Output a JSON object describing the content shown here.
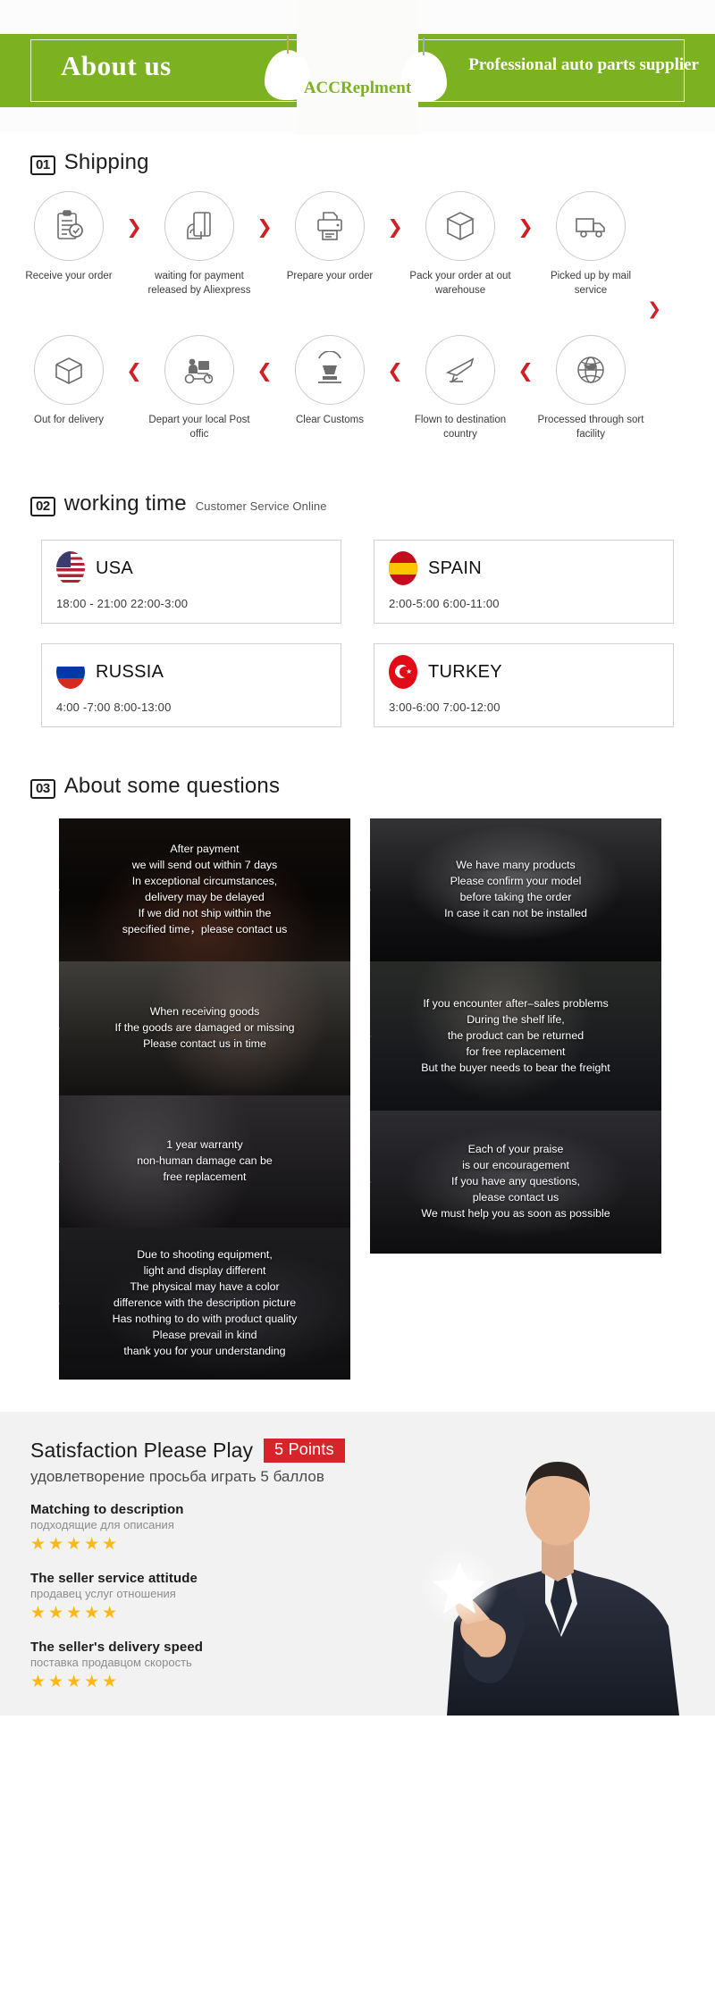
{
  "header": {
    "title": "About us",
    "slogan": "Professional auto parts supplier",
    "logo_text": "ACCReplment",
    "band_color": "#7cb122"
  },
  "shipping": {
    "number": "01",
    "title": "Shipping",
    "arrow_right": "❯",
    "arrow_down": "❯",
    "row1": [
      {
        "icon": "clipboard-check-icon",
        "label": "Receive your order"
      },
      {
        "icon": "hand-card-icon",
        "label": "waiting for payment\nreleased by Aliexpress"
      },
      {
        "icon": "printer-icon",
        "label": "Prepare your order"
      },
      {
        "icon": "box-icon",
        "label": "Pack your order at\nout warehouse"
      },
      {
        "icon": "truck-icon",
        "label": "Picked up by\nmail service"
      }
    ],
    "row2": [
      {
        "icon": "open-box-icon",
        "label": "Out  for delivery"
      },
      {
        "icon": "scooter-courier-icon",
        "label": "Depart your local\nPost offic"
      },
      {
        "icon": "customs-stamp-icon",
        "label": "Clear Customs"
      },
      {
        "icon": "airplane-icon",
        "label": "Flown to\ndestination country"
      },
      {
        "icon": "globe-icon",
        "label": "Processed through\nsort facility"
      }
    ]
  },
  "working_time": {
    "number": "02",
    "title": "working time",
    "subtitle": "Customer Service Online",
    "cards": [
      {
        "flag": "flag-usa-icon",
        "country": "USA",
        "hours": "18:00 - 21:00   22:00-3:00"
      },
      {
        "flag": "flag-spain-icon",
        "country": "SPAIN",
        "hours": "2:00-5:00    6:00-11:00"
      },
      {
        "flag": "flag-russia-icon",
        "country": "RUSSIA",
        "hours": "4:00 -7:00   8:00-13:00"
      },
      {
        "flag": "flag-turkey-icon",
        "country": "TURKEY",
        "hours": "3:00-6:00    7:00-12:00"
      }
    ]
  },
  "questions": {
    "number": "03",
    "title": "About some questions",
    "left_column": [
      {
        "marker_color": "#f07a7a",
        "text": "After payment\nwe will send out within 7 days\nIn exceptional circumstances,\ndelivery may be delayed\nIf we did not ship within the\nspecified time，please contact us"
      },
      {
        "marker_color": "#3ddcc0",
        "text": "When receiving goods\nIf the goods are damaged or missing\nPlease contact us in time"
      },
      {
        "marker_color": "#3ddcc0",
        "text": "1 year warranty\nnon-human damage can be\nfree replacement"
      },
      {
        "marker_color": "#e14ec0",
        "text": "Due to shooting equipment,\nlight and display different\nThe physical may have a color\ndifference with the description picture\nHas nothing to do with product quality\nPlease prevail in kind\nthank you for your understanding"
      }
    ],
    "right_column": [
      {
        "marker_color": "#3ddcc0",
        "text": "We have many products\nPlease confirm your model\nbefore taking the order\nIn case it can not be installed"
      },
      {
        "marker_color": "#24b9a6",
        "text": "If you encounter after–sales problems\nDuring the shelf life,\nthe product can be returned\nfor free replacement\nBut the buyer needs to bear the freight"
      },
      {
        "marker_color": "#2fb34a",
        "text": "Each of your praise\nis our encouragement\nIf you have any questions,\nplease contact us\nWe must help you as soon as possible"
      }
    ]
  },
  "satisfaction": {
    "title": "Satisfaction Please Play",
    "badge": "5 Points",
    "subtitle": "удовлетворение просьба играть 5 баллов",
    "badge_color": "#d8232a",
    "star_color": "#fdb913",
    "stars_glyph": "★★★★★",
    "items": [
      {
        "en": "Matching to description",
        "ru": "подходящие для описания",
        "rating": 5
      },
      {
        "en": "The seller service attitude",
        "ru": "продавец услуг отношения",
        "rating": 5
      },
      {
        "en": "The seller's delivery speed",
        "ru": "поставка продавцом скорость",
        "rating": 5
      }
    ]
  }
}
